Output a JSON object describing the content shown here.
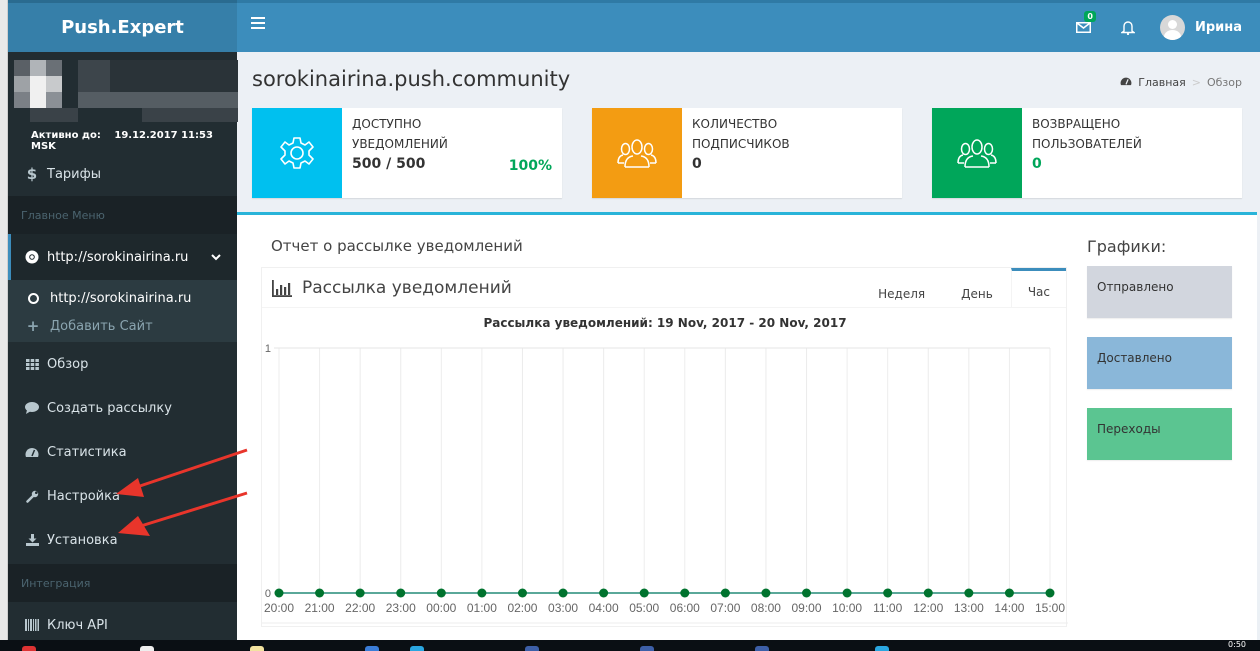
{
  "app": {
    "logo": "Push.Expert",
    "active_until_label": "Активно до:",
    "active_until_value": "19.12.2017 11:53 MSK"
  },
  "sidebar": {
    "tariffs": {
      "icon": "dollar-icon",
      "label": "Тарифы"
    },
    "main_menu_header": "Главное Меню",
    "site_menu": {
      "icon": "chrome-icon",
      "label": "http://sorokinairina.ru",
      "expanded": true
    },
    "site_submenu": [
      {
        "icon": "circle-icon",
        "label": "http://sorokinairina.ru"
      },
      {
        "icon": "plus-icon",
        "label": "Добавить Сайт"
      }
    ],
    "items": [
      {
        "icon": "grid-icon",
        "label": "Обзор"
      },
      {
        "icon": "comment-icon",
        "label": "Создать рассылку"
      },
      {
        "icon": "dashboard-icon",
        "label": "Статистика"
      },
      {
        "icon": "wrench-icon",
        "label": "Настройка"
      },
      {
        "icon": "download-icon",
        "label": "Установка"
      }
    ],
    "integration_header": "Интеграция",
    "integration_items": [
      {
        "icon": "barcode-icon",
        "label": "Ключ API"
      }
    ]
  },
  "topbar": {
    "messages_badge": "0",
    "user_name": "Ирина"
  },
  "page": {
    "title": "sorokinairina.push.community",
    "breadcrumb": [
      {
        "icon": "dashboard-icon",
        "label": "Главная"
      },
      {
        "label": "Обзор"
      }
    ]
  },
  "info_boxes": [
    {
      "icon": "gear-icon",
      "label_line1": "Доступно",
      "label_line2": "уведомлений",
      "value": "500 / 500",
      "percent": "100%",
      "color": "#00c0ef"
    },
    {
      "icon": "users-icon",
      "label_line1": "Количество",
      "label_line2": "подписчиков",
      "value": "0",
      "color": "#f39c12"
    },
    {
      "icon": "users-icon",
      "label_line1": "Возвращено",
      "label_line2": "пользователей",
      "value": "0",
      "color": "#00a65a"
    }
  ],
  "report": {
    "title": "Отчет о рассылке уведомлений",
    "chart_box_title": "Рассылка уведомлений",
    "tabs": [
      {
        "label": "Неделя",
        "active": false
      },
      {
        "label": "День",
        "active": false
      },
      {
        "label": "Час",
        "active": true
      }
    ]
  },
  "graphs_panel": {
    "title": "Графики:",
    "buttons": [
      {
        "label": "Отправлено",
        "color": "#d2d6de"
      },
      {
        "label": "Доставлено",
        "color": "#8ab7d9"
      },
      {
        "label": "Переходы",
        "color": "#5bc591"
      }
    ]
  },
  "chart_data": {
    "type": "line",
    "title": "Рассылка уведомлений: 19 Nov, 2017 - 20 Nov, 2017",
    "xlabel": "",
    "ylabel": "",
    "x": [
      "20:00",
      "21:00",
      "22:00",
      "23:00",
      "00:00",
      "01:00",
      "02:00",
      "03:00",
      "04:00",
      "05:00",
      "06:00",
      "07:00",
      "08:00",
      "09:00",
      "10:00",
      "11:00",
      "12:00",
      "13:00",
      "14:00",
      "15:00"
    ],
    "series": [
      {
        "name": "Отправлено",
        "values": [
          0,
          0,
          0,
          0,
          0,
          0,
          0,
          0,
          0,
          0,
          0,
          0,
          0,
          0,
          0,
          0,
          0,
          0,
          0,
          0
        ],
        "color": "#00732e"
      }
    ],
    "ylim": [
      0,
      1
    ],
    "yticks": [
      "0",
      "1"
    ],
    "grid": true,
    "legend": "none"
  },
  "taskbar": {
    "clock": "0:50"
  }
}
